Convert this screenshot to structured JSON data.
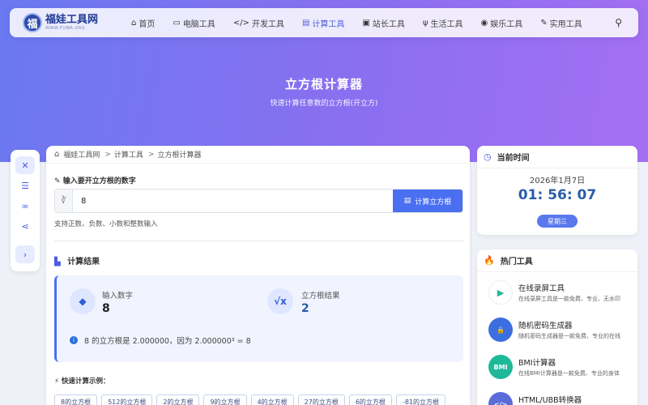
{
  "nav": {
    "logo_mark": "福",
    "logo_title": "福娃工具网",
    "logo_sub": "WWW.FUWA.ORG",
    "items": [
      {
        "label": "首页",
        "icon": "home-icon",
        "glyph": "⌂",
        "active": false
      },
      {
        "label": "电脑工具",
        "icon": "monitor-icon",
        "glyph": "▭",
        "active": false
      },
      {
        "label": "开发工具",
        "icon": "code-icon",
        "glyph": "</>",
        "active": false
      },
      {
        "label": "计算工具",
        "icon": "calculator-icon",
        "glyph": "▤",
        "active": true
      },
      {
        "label": "站长工具",
        "icon": "toolbox-icon",
        "glyph": "▣",
        "active": false
      },
      {
        "label": "生活工具",
        "icon": "utensils-icon",
        "glyph": "ψ",
        "active": false
      },
      {
        "label": "娱乐工具",
        "icon": "gamepad-icon",
        "glyph": "◉",
        "active": false
      },
      {
        "label": "实用工具",
        "icon": "wrench-icon",
        "glyph": "✎",
        "active": false
      }
    ]
  },
  "hero": {
    "title": "立方根计算器",
    "subtitle": "快速计算任意数的立方根(开立方)"
  },
  "breadcrumb": {
    "home": "福娃工具网",
    "category": "计算工具",
    "current": "立方根计算器"
  },
  "form": {
    "label": "输入要开立方根的数字",
    "value": "8",
    "button": "计算立方根",
    "hint": "支持正数、负数、小数和整数输入"
  },
  "result": {
    "title": "计算结果",
    "input_label": "输入数字",
    "input_value": "8",
    "output_label": "立方根结果",
    "output_value": "2",
    "description": "8 的立方根是 2.000000，因为 2.000000³ = 8"
  },
  "quick": {
    "title": "快速计算示例：",
    "chips": [
      "8的立方根",
      "512的立方根",
      "2的立方根",
      "9的立方根",
      "4的立方根",
      "27的立方根",
      "6的立方根",
      "-81的立方根"
    ]
  },
  "time_card": {
    "title": "当前时间",
    "date": "2026年1月7日",
    "clock": "01: 56: 07",
    "weekday": "星期三"
  },
  "hot_tools": {
    "title": "热门工具",
    "items": [
      {
        "name": "在线录屏工具",
        "desc": "在线录屏工具是一款免费、专业、无水印",
        "color": "#ffffff",
        "badge": "▶"
      },
      {
        "name": "随机密码生成器",
        "desc": "随机密码生成器是一款免费、专业的在线",
        "color": "#3b6fe0",
        "badge": "🔒"
      },
      {
        "name": "BMI计算器",
        "desc": "在线BMI计算器是一款免费、专业的身体",
        "color": "#1fb89a",
        "badge": "BMI"
      },
      {
        "name": "HTML/UBB转换器",
        "desc": "",
        "color": "#5b6bd8",
        "badge": "</>"
      }
    ]
  },
  "colors": {
    "accent": "#4a6ff0",
    "clock": "#2a5caa",
    "hero_start": "#6a79f0",
    "hero_end": "#a56ff2"
  }
}
